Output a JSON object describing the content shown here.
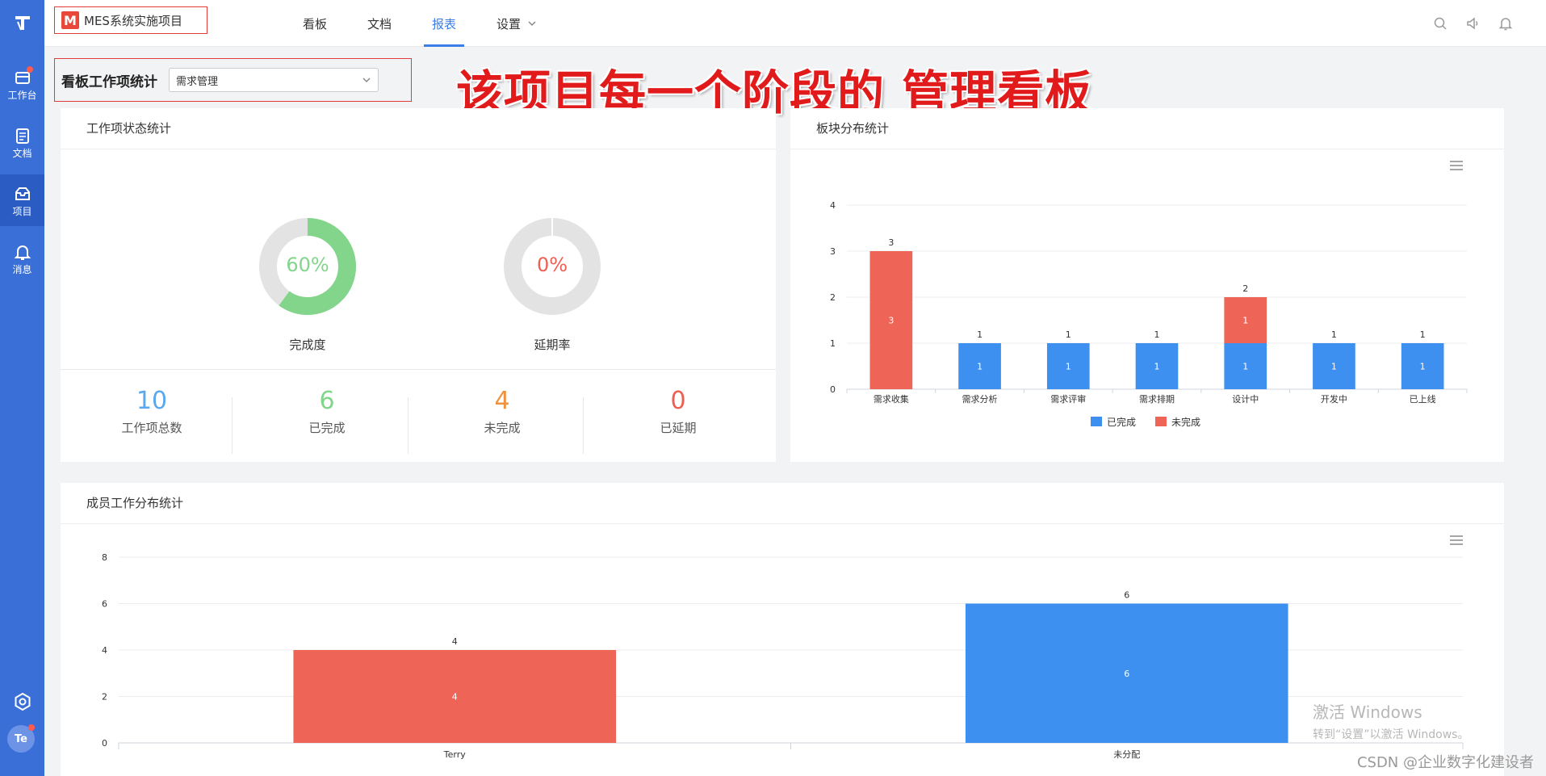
{
  "sidebar": {
    "items": [
      {
        "label": "工作台",
        "icon": "workbench-icon"
      },
      {
        "label": "文档",
        "icon": "document-icon"
      },
      {
        "label": "项目",
        "icon": "project-icon"
      },
      {
        "label": "消息",
        "icon": "bell-icon"
      }
    ],
    "avatar": "Te"
  },
  "topbar": {
    "project_logo": "M",
    "project_name": "MES系统实施项目",
    "nav": [
      "看板",
      "文档",
      "报表",
      "设置"
    ],
    "active_nav": "报表"
  },
  "selector": {
    "label": "看板工作项统计",
    "value": "需求管理"
  },
  "banner": "该项目每一个阶段的 管理看板",
  "status_panel": {
    "title": "工作项状态统计",
    "completion": {
      "pct_text": "60%",
      "value": 0.6,
      "label": "完成度"
    },
    "delay": {
      "pct_text": "0%",
      "value": 0,
      "label": "延期率"
    },
    "stats": [
      {
        "value": "10",
        "label": "工作项总数",
        "color": "#5aa9ef"
      },
      {
        "value": "6",
        "label": "已完成",
        "color": "#82d58a"
      },
      {
        "value": "4",
        "label": "未完成",
        "color": "#f0913c"
      },
      {
        "value": "0",
        "label": "已延期",
        "color": "#ee5e52"
      }
    ]
  },
  "chart_data": [
    {
      "type": "bar",
      "stacked": true,
      "title": "板块分布统计",
      "categories": [
        "需求收集",
        "需求分析",
        "需求评审",
        "需求排期",
        "设计中",
        "开发中",
        "已上线"
      ],
      "series": [
        {
          "name": "已完成",
          "color": "#3d8ff0",
          "values": [
            0,
            1,
            1,
            1,
            1,
            1,
            1
          ]
        },
        {
          "name": "未完成",
          "color": "#ee6557",
          "values": [
            3,
            0,
            0,
            0,
            1,
            0,
            0
          ]
        }
      ],
      "ylim": [
        0,
        4
      ],
      "yticks": [
        0,
        1,
        2,
        3,
        4
      ],
      "legend": "bottom",
      "grid": true
    },
    {
      "type": "bar",
      "title": "成员工作分布统计",
      "categories": [
        "Terry",
        "未分配"
      ],
      "values": [
        4,
        6
      ],
      "colors": [
        "#ee6557",
        "#3d8ff0"
      ],
      "ylim": [
        0,
        8
      ],
      "yticks": [
        0,
        2,
        4,
        6,
        8
      ],
      "grid": true
    }
  ],
  "watermark": {
    "line1": "激活 Windows",
    "line2": "转到“设置”以激活 Windows。"
  },
  "credit": "CSDN @企业数字化建设者"
}
